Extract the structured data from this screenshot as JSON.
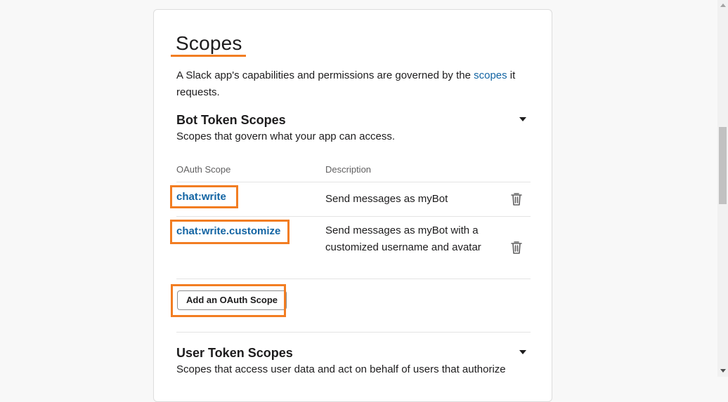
{
  "page": {
    "title": "Scopes",
    "intro_text": "A Slack app's capabilities and permissions are governed by the ",
    "intro_link": "scopes",
    "intro_text_end": " it requests."
  },
  "bot_scopes": {
    "title": "Bot Token Scopes",
    "subtitle": "Scopes that govern what your app can access.",
    "col_scope": "OAuth Scope",
    "col_description": "Description",
    "rows": [
      {
        "name": "chat:write",
        "description": "Send messages as myBot"
      },
      {
        "name": "chat:write.customize",
        "description": "Send messages as myBot with a customized username and avatar"
      }
    ],
    "add_button": "Add an OAuth Scope"
  },
  "user_scopes": {
    "title": "User Token Scopes",
    "subtitle": "Scopes that access user data and act on behalf of users that authorize"
  },
  "colors": {
    "highlight": "#f27d22",
    "link": "#1264a3"
  }
}
